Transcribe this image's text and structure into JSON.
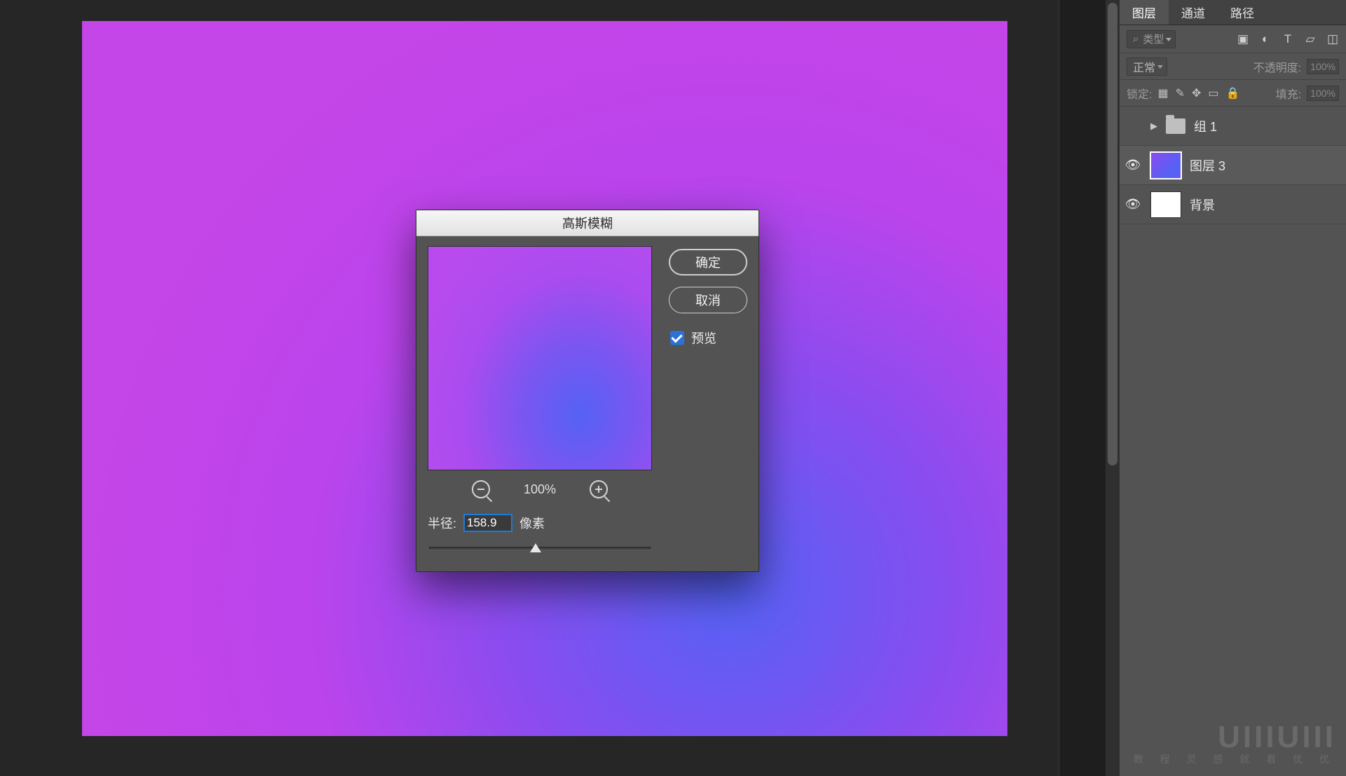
{
  "dialog": {
    "title": "高斯模糊",
    "ok": "确定",
    "cancel": "取消",
    "preview": "预览",
    "zoom": "100%",
    "radius_label": "半径:",
    "radius_value": "158.9",
    "radius_unit": "像素"
  },
  "panel": {
    "tabs": {
      "layers": "图层",
      "channels": "通道",
      "paths": "路径"
    },
    "kind_filter": "类型",
    "blend_mode": "正常",
    "opacity_label": "不透明度:",
    "opacity_value": "100%",
    "lock_label": "锁定:",
    "fill_label": "填充:",
    "fill_value": "100%"
  },
  "layers": {
    "group1": "组 1",
    "layer3": "图层 3",
    "background": "背景"
  },
  "watermark": {
    "logo": "UIIIUIII",
    "sub": "教 程 灵 感 就 看 优 优"
  }
}
